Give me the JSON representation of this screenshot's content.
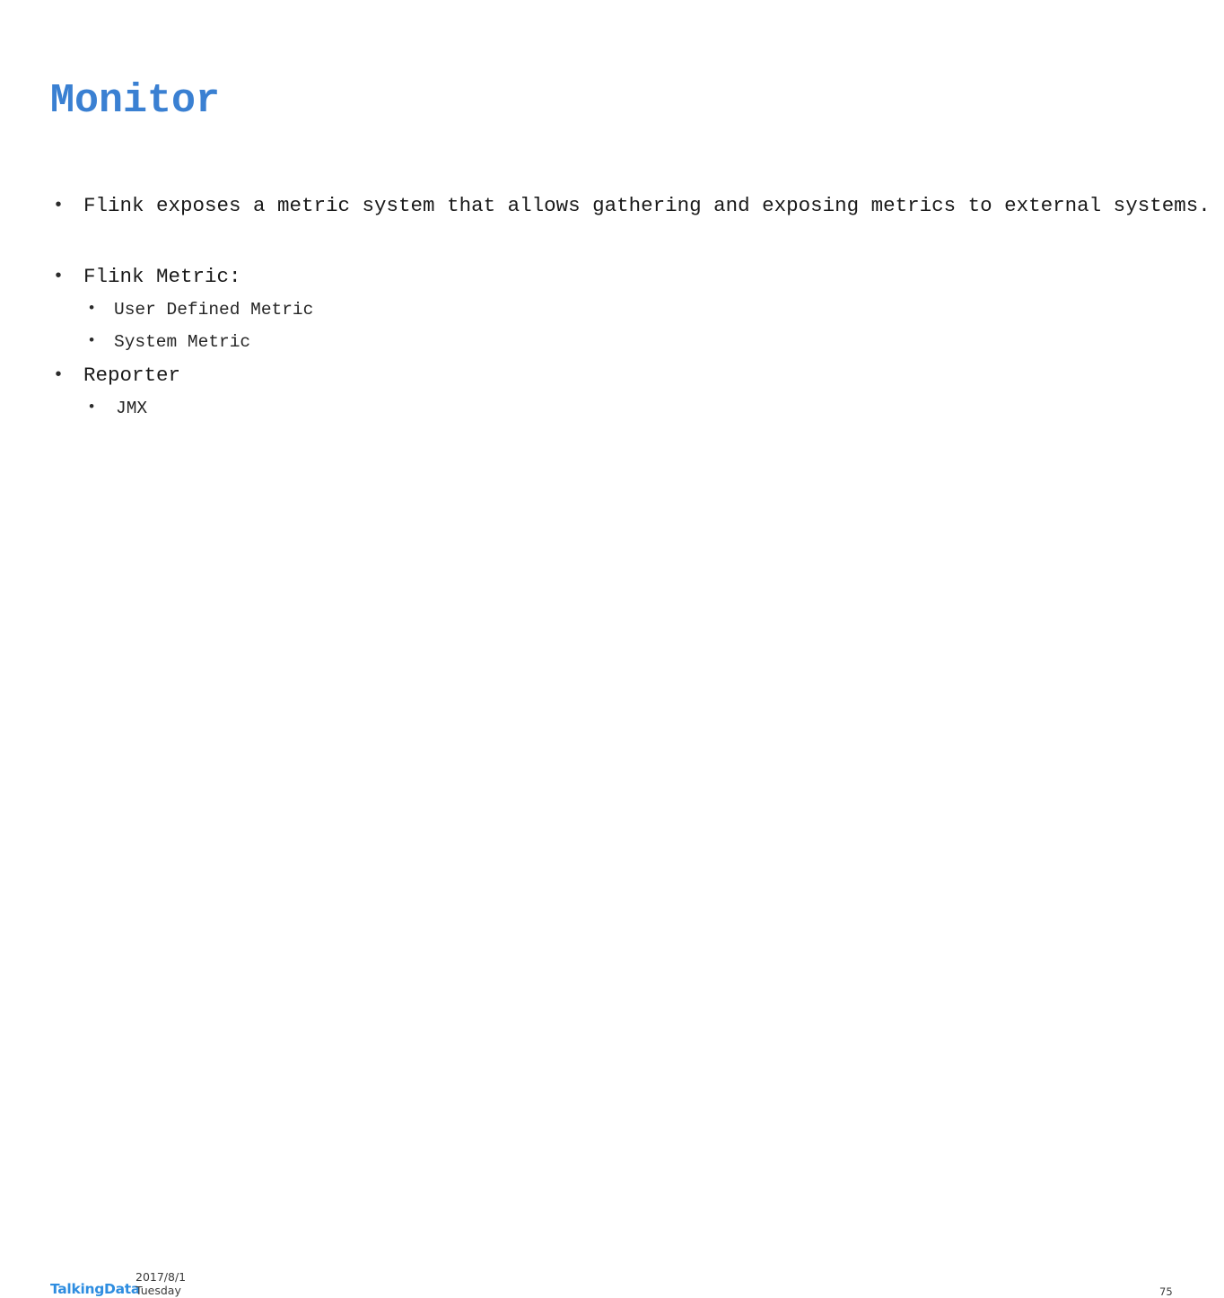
{
  "slide": {
    "title": "Monitor",
    "title_color": "#3a80d2",
    "background_color": "#ffffff",
    "body_text_color": "#1a1a1a"
  },
  "content": {
    "bullets": [
      {
        "text": "Flink exposes a metric system that allows gathering and exposing metrics to external systems.",
        "marker": "•",
        "sub_items": []
      },
      {
        "text": "Flink Metric:",
        "marker": "•",
        "sub_items": [
          {
            "text": "User Defined Metric",
            "marker": "•"
          },
          {
            "text": "System Metric",
            "marker": "•"
          }
        ]
      },
      {
        "text": "Reporter",
        "marker": "•",
        "sub_items": [
          {
            "text": "JMX",
            "marker": "•"
          }
        ]
      }
    ]
  },
  "footer": {
    "logo_text": "TalkingData",
    "logo_color": "#2e8de0",
    "date": "2017/8/1",
    "weekday": "Tuesday",
    "page_number": "75"
  }
}
